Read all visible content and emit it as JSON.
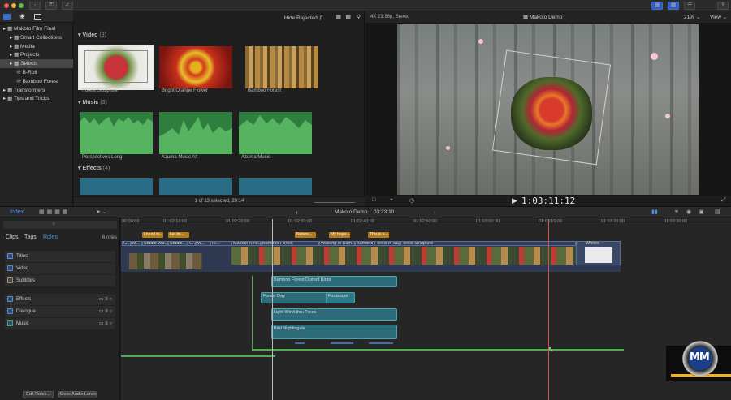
{
  "toolbar": {
    "key_icon": "key-icon",
    "check_icon": "checkmark-icon",
    "download_icon": "download-icon"
  },
  "library": {
    "items": [
      {
        "label": "Makoto Film Final",
        "indent": 0,
        "selected": false
      },
      {
        "label": "Smart Collections",
        "indent": 1,
        "selected": false
      },
      {
        "label": "Media",
        "indent": 1,
        "selected": false
      },
      {
        "label": "Projects",
        "indent": 1,
        "selected": false
      },
      {
        "label": "Selects",
        "indent": 1,
        "selected": true
      },
      {
        "label": "B-Roll",
        "indent": 2,
        "selected": false
      },
      {
        "label": "Bamboo Forest",
        "indent": 2,
        "selected": false
      },
      {
        "label": "Transformers",
        "indent": 0,
        "selected": false
      },
      {
        "label": "Tips and Tricks",
        "indent": 0,
        "selected": false
      }
    ]
  },
  "browser": {
    "filter": "Hide Rejected",
    "video_title": "Video",
    "video_count": "(3)",
    "music_title": "Music",
    "music_count": "(3)",
    "effects_title": "Effects",
    "effects_count": "(4)",
    "video_clips": [
      "Forest Sculpture",
      "Bright Orange Flower",
      "Bamboo Forest"
    ],
    "music_clips": [
      "Perspectives Long",
      "Azuma Music Alt",
      "Azuma Music"
    ],
    "status": "1 of 13 selected, 29:14"
  },
  "viewer": {
    "format": "4K 23.98p, Stereo",
    "title": "Makoto Demo",
    "zoom": "21%",
    "view": "View",
    "timecode": "1:03:11:12"
  },
  "timeline_header": {
    "index_tab": "Index",
    "project": "Makoto Demo",
    "duration": "03:23:10"
  },
  "index": {
    "tabs": [
      "Clips",
      "Tags",
      "Roles"
    ],
    "roles_count": "6 roles",
    "roles": [
      "Titles",
      "Video",
      "Subtitles",
      "Effects",
      "Dialogue",
      "Music"
    ],
    "edit_roles": "Edit Roles...",
    "show_audio_lanes": "Show Audio Lanes"
  },
  "timeline": {
    "ruler": [
      "00:00:00",
      "01:02:10:00",
      "01:02:20:00",
      "01:02:30:00",
      "01:02:40:00",
      "01:02:50:00",
      "01:03:00:00",
      "01:03:10:00",
      "01:03:20:00",
      "01:03:30:00"
    ],
    "captions": [
      "I need to...",
      "but its...",
      "Nature...",
      "My hope...",
      "This is s..."
    ],
    "video_clips": [
      "G...",
      "M...",
      "Studio W3...",
      "Studio...",
      "C...",
      "W...",
      "Fl...",
      "Makoto Revi...",
      "Bamboo Forest",
      "Walking in Bam...",
      "Bamboo Forest in Su...",
      "Forest Sculpture",
      "Whites"
    ],
    "audio_clips": [
      "Bamboo Forest Distant Birds",
      "Forest Day",
      "Footsteps",
      "Light Wind thru Trees",
      "Bird Nightingale"
    ]
  }
}
